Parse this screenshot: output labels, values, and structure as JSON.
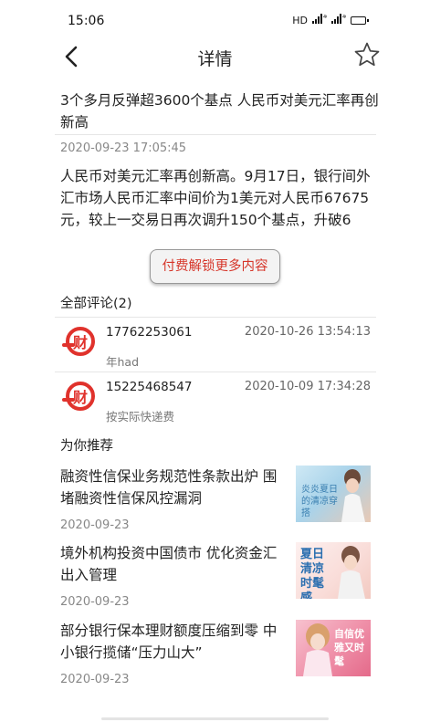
{
  "status_bar": {
    "time": "15:06",
    "network": "HD",
    "signal1": "4G",
    "signal2": "4G"
  },
  "nav": {
    "title": "详情",
    "back_icon": "chevron-left-icon",
    "favorite_icon": "star-outline-icon"
  },
  "article": {
    "title": "3个多月反弹超3600个基点 人民币对美元汇率再创新高",
    "time": "2020-09-23 17:05:45",
    "body": "人民币对美元汇率再创新高。9月17日，银行间外汇市场人民币汇率中间价为1美元对人民币67675元，较上一交易日再次调升150个基点，升破6",
    "unlock_label": "付费解锁更多内容"
  },
  "comments": {
    "heading": "全部评论(2)",
    "items": [
      {
        "user": "17762253061",
        "date": "2020-10-26 13:54:13",
        "text": "年had"
      },
      {
        "user": "15225468547",
        "date": "2020-10-09 17:34:28",
        "text": "按实际快递费"
      }
    ]
  },
  "recommend": {
    "heading": "为你推荐",
    "items": [
      {
        "title": "融资性信保业务规范性条款出炉 围堵融资性信保风控漏洞",
        "date": "2020-09-23",
        "thumb_text": "炎炎夏日的清凉穿搭"
      },
      {
        "title": "境外机构投资中国债市 优化资金汇出入管理",
        "date": "2020-09-23",
        "thumb_text": "夏日清凉时髦感"
      },
      {
        "title": "部分银行保本理财额度压缩到零 中小银行揽储“压力山大”",
        "date": "2020-09-23",
        "thumb_text": "自信优雅又时髦"
      }
    ]
  },
  "colors": {
    "accent_red": "#d6362a",
    "avatar_red": "#e0322c"
  }
}
